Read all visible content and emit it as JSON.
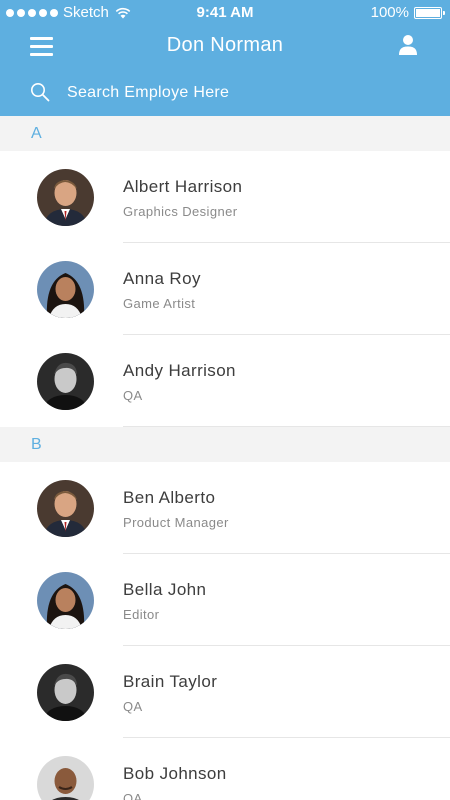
{
  "status_bar": {
    "carrier": "Sketch",
    "time": "9:41 AM",
    "battery": "100%"
  },
  "nav": {
    "title": "Don Norman"
  },
  "search": {
    "placeholder": "Search Employe Here"
  },
  "sections": [
    {
      "letter": "A",
      "employees": [
        {
          "name": "Albert Harrison",
          "role": "Graphics Designer",
          "avatar": "man-suit"
        },
        {
          "name": "Anna Roy",
          "role": "Game Artist",
          "avatar": "woman-dark-hair"
        },
        {
          "name": "Andy Harrison",
          "role": "QA",
          "avatar": "man-bw"
        }
      ]
    },
    {
      "letter": "B",
      "employees": [
        {
          "name": "Ben Alberto",
          "role": "Product Manager",
          "avatar": "man-suit"
        },
        {
          "name": "Bella John",
          "role": "Editor",
          "avatar": "woman-dark-hair"
        },
        {
          "name": "Brain Taylor",
          "role": "QA",
          "avatar": "man-bw"
        },
        {
          "name": "Bob Johnson",
          "role": "QA",
          "avatar": "man-bald"
        }
      ]
    }
  ],
  "colors": {
    "accent": "#5eafe0",
    "section_bg": "#f3f3f3",
    "name": "#3d3d3d",
    "role": "#8a8a8a"
  }
}
